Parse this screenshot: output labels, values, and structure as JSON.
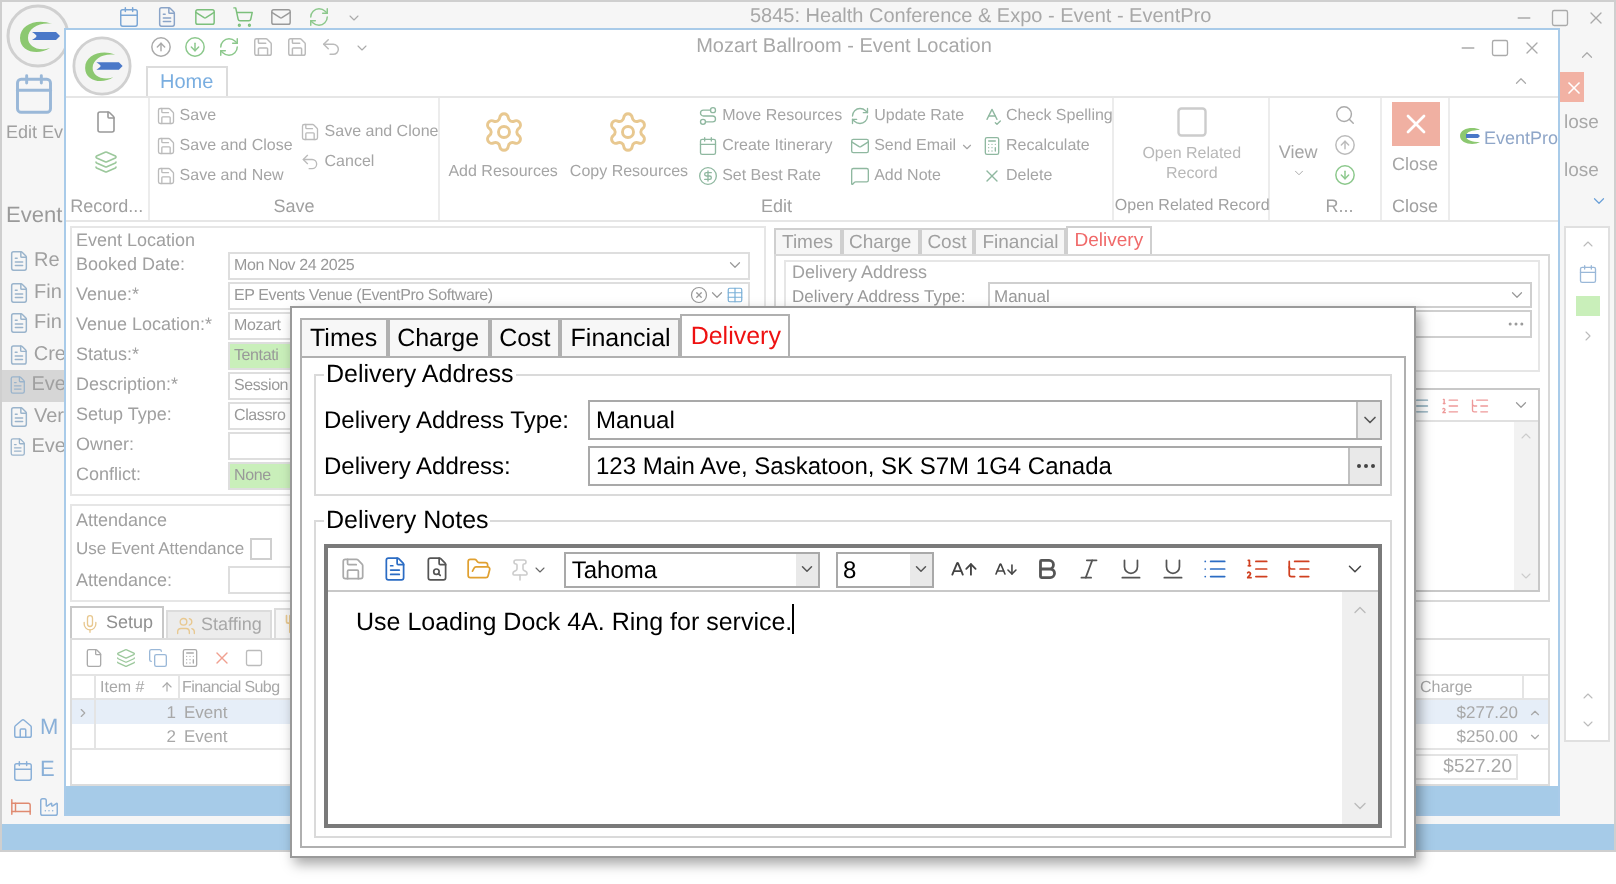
{
  "back_window": {
    "title": "5845: Health Conference & Expo - Event - EventPro",
    "ribbon_button": "Edit Ev",
    "section_title": "Event",
    "nav_items": [
      {
        "label": "Re",
        "selected": false
      },
      {
        "label": "Fin",
        "selected": false
      },
      {
        "label": "Fin",
        "selected": false
      },
      {
        "label": "Cre",
        "selected": false
      },
      {
        "label": "Eve",
        "selected": true
      },
      {
        "label": "Ver",
        "selected": false
      },
      {
        "label": "Eve",
        "selected": false
      }
    ],
    "bottom_nav": [
      "M",
      "E"
    ],
    "close_labels": [
      "lose",
      "lose"
    ]
  },
  "event_window": {
    "title": "Mozart Ballroom - Event Location",
    "ribbon_tabs": [
      {
        "label": "Home",
        "selected": true
      }
    ],
    "record_group": "Record...",
    "save_group": {
      "label": "Save",
      "items": [
        "Save",
        "Save and Close",
        "Save and New",
        "Save and Clone",
        "Cancel"
      ]
    },
    "edit_group": {
      "label": "Edit",
      "large": [
        "Add Resources",
        "Copy Resources"
      ],
      "small": [
        {
          "label": "Move Resources"
        },
        {
          "label": "Create Itinerary"
        },
        {
          "label": "Set Best Rate"
        },
        {
          "label": "Update Rate"
        },
        {
          "label": "Send Email",
          "has_menu": true
        },
        {
          "label": "Add Note"
        },
        {
          "label": "Check Spelling"
        },
        {
          "label": "Recalculate"
        },
        {
          "label": "Delete"
        }
      ]
    },
    "related_group": {
      "label": "Open Related Record",
      "button": "Open Related Record"
    },
    "view_group": {
      "label": "R...",
      "button": "View"
    },
    "close_group": {
      "label": "Close",
      "button": "Close"
    },
    "logo": "EventPro",
    "location": {
      "title": "Event Location",
      "fields": [
        {
          "label": "Booked Date:",
          "value": "Mon Nov 24 2025",
          "kind": "dropdown"
        },
        {
          "label": "Venue:*",
          "value": "EP Events Venue (EventPro Software)",
          "kind": "lookup"
        },
        {
          "label": "Venue Location:*",
          "value": "Mozart",
          "kind": "text"
        },
        {
          "label": "Status:*",
          "value": "Tentati",
          "kind": "status"
        },
        {
          "label": "Description:*",
          "value": "Session",
          "kind": "text"
        },
        {
          "label": "Setup Type:",
          "value": "Classro",
          "kind": "text"
        },
        {
          "label": "Owner:",
          "kind": "text"
        },
        {
          "label": "Conflict:",
          "value": "None",
          "kind": "status"
        }
      ]
    },
    "attendance": {
      "title": "Attendance",
      "use_label": "Use Event Attendance",
      "use_checked": false,
      "attendance_label": "Attendance:"
    },
    "right_panel": {
      "tabs": [
        {
          "label": "Times",
          "selected": false
        },
        {
          "label": "Charge",
          "selected": false
        },
        {
          "label": "Cost",
          "selected": false
        },
        {
          "label": "Financial",
          "selected": false
        },
        {
          "label": "Delivery",
          "selected": true
        }
      ],
      "group": "Delivery Address",
      "type_label": "Delivery Address Type:",
      "type_value": "Manual"
    },
    "bottom_tabs": [
      {
        "label": "Setup",
        "selected": true
      },
      {
        "label": "Staffing",
        "selected": false
      }
    ],
    "grid": {
      "columns": [
        "Item #",
        "Financial Subg",
        "Charge"
      ],
      "rows": [
        {
          "cells": [
            "1",
            "Event",
            "$277.20"
          ],
          "selected": true
        },
        {
          "cells": [
            "2",
            "Event",
            "$250.00"
          ],
          "selected": false
        }
      ],
      "total": "$527.20"
    }
  },
  "delivery_dialog": {
    "tabs": [
      {
        "label": "Times",
        "selected": false
      },
      {
        "label": "Charge",
        "selected": false
      },
      {
        "label": "Cost",
        "selected": false
      },
      {
        "label": "Financial",
        "selected": false
      },
      {
        "label": "Delivery",
        "selected": true
      }
    ],
    "address": {
      "title": "Delivery Address",
      "type_label": "Delivery Address Type:",
      "type_value": "Manual",
      "address_label": "Delivery Address:",
      "address_value": "123 Main Ave, Saskatoon, SK S7M 1G4 Canada"
    },
    "notes": {
      "title": "Delivery Notes",
      "font": "Tahoma",
      "size": "8",
      "text": "Use Loading Dock 4A. Ring for service."
    }
  }
}
